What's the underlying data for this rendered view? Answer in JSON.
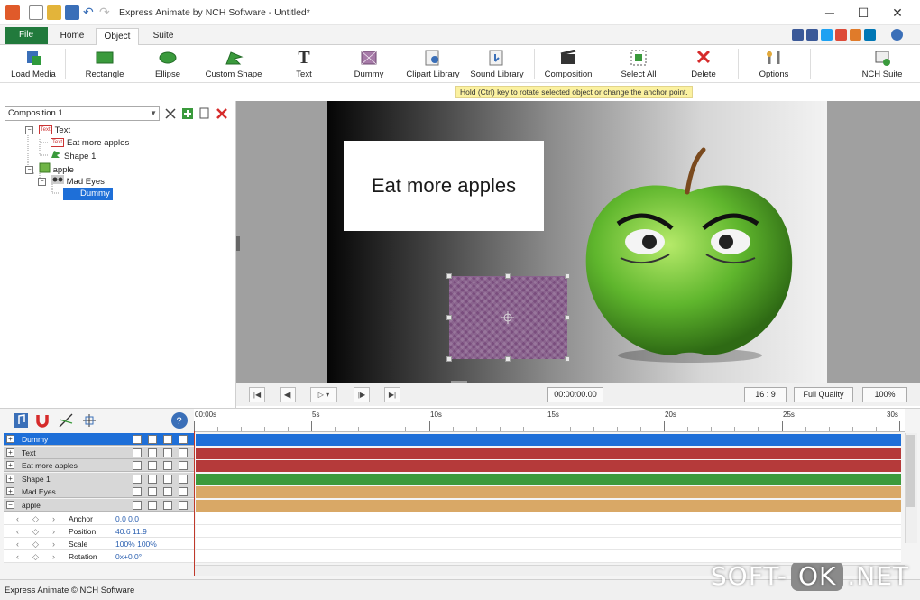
{
  "app": {
    "title": "Express Animate by NCH Software - Untitled*",
    "minimize": "─",
    "maximize": "☐",
    "close": "✕"
  },
  "ribbon": {
    "tabs": [
      "File",
      "Home",
      "Object",
      "Suite"
    ],
    "active_tab": "Object"
  },
  "toolbar": {
    "items": [
      {
        "label": "Load Media",
        "icon": "load-media-icon"
      },
      {
        "label": "Rectangle",
        "icon": "rectangle-icon"
      },
      {
        "label": "Ellipse",
        "icon": "ellipse-icon"
      },
      {
        "label": "Custom Shape",
        "icon": "custom-shape-icon"
      },
      {
        "label": "Text",
        "icon": "text-icon"
      },
      {
        "label": "Dummy",
        "icon": "dummy-icon"
      },
      {
        "label": "Clipart Library",
        "icon": "clipart-library-icon"
      },
      {
        "label": "Sound Library",
        "icon": "sound-library-icon"
      },
      {
        "label": "Composition",
        "icon": "composition-icon"
      },
      {
        "label": "Select All",
        "icon": "select-all-icon"
      },
      {
        "label": "Delete",
        "icon": "delete-icon"
      },
      {
        "label": "Options",
        "icon": "options-icon"
      },
      {
        "label": "NCH Suite",
        "icon": "nch-suite-icon"
      }
    ],
    "hint": "Hold (Ctrl) key to rotate selected object or change the anchor point."
  },
  "left_panel": {
    "composition": "Composition 1",
    "tree": [
      {
        "label": "Text",
        "badge": "Text",
        "depth": 0
      },
      {
        "label": "Eat more apples",
        "badge": "Text",
        "depth": 1
      },
      {
        "label": "Shape 1",
        "depth": 1
      },
      {
        "label": "apple",
        "depth": 0
      },
      {
        "label": "Mad Eyes",
        "depth": 1
      },
      {
        "label": "Dummy",
        "depth": 2,
        "selected": true
      }
    ]
  },
  "canvas": {
    "text_object": "Eat more apples"
  },
  "transport": {
    "timecode": "00:00:00.00",
    "aspect": "16 : 9",
    "quality": "Full Quality",
    "zoom": "100%"
  },
  "timeline": {
    "ruler": [
      "00:00s",
      "5s",
      "10s",
      "15s",
      "20s",
      "25s",
      "30s"
    ],
    "layers": [
      {
        "name": "Dummy",
        "color": "#1e6fd8",
        "selected": true
      },
      {
        "name": "Text",
        "color": "#b53a3a"
      },
      {
        "name": "Eat more apples",
        "color": "#b53a3a"
      },
      {
        "name": "Shape 1",
        "color": "#3c9a3c"
      },
      {
        "name": "Mad Eyes",
        "color": "#d9a866"
      },
      {
        "name": "apple",
        "color": "#d9a866"
      }
    ],
    "properties": [
      {
        "name": "Anchor",
        "value": "0.0  0.0"
      },
      {
        "name": "Position",
        "value": "40.6  11.9"
      },
      {
        "name": "Scale",
        "value": "100%  100%"
      },
      {
        "name": "Rotation",
        "value": "0x+0.0°"
      }
    ]
  },
  "status": "Express Animate © NCH Software",
  "watermark": {
    "left": "SOFT-",
    "ok": "OK",
    "right": ".NET"
  }
}
